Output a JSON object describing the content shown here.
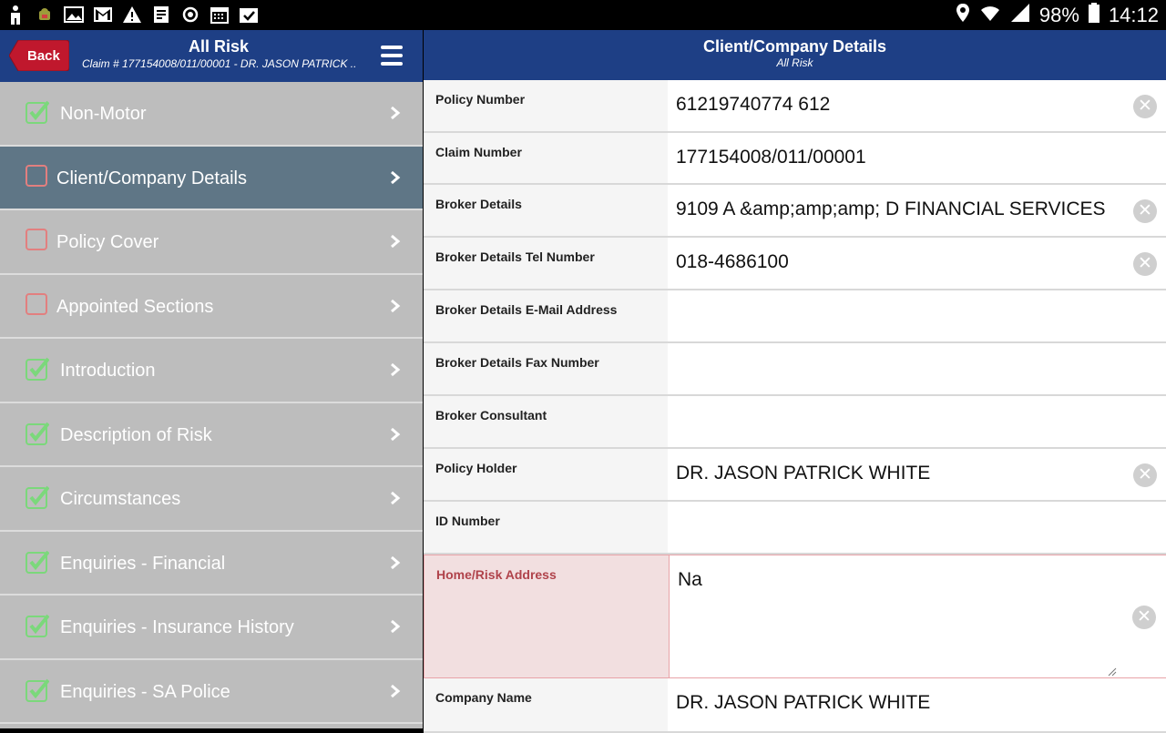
{
  "status_bar": {
    "battery": "98%",
    "time": "14:12",
    "icons": [
      "person-icon",
      "android-icon",
      "image-icon",
      "gmail-icon",
      "warning-icon",
      "document-icon",
      "sync-icon",
      "calendar-icon",
      "clipboard-check-icon",
      "location-icon",
      "wifi-icon",
      "signal-icon",
      "battery-icon"
    ]
  },
  "left_header": {
    "back_label": "Back",
    "title": "All Risk",
    "subtitle": "Claim # 177154008/011/00001 - DR. JASON PATRICK ..."
  },
  "nav": {
    "items": [
      {
        "label": "Non-Motor",
        "state": "checked"
      },
      {
        "label": "Client/Company Details",
        "state": "active"
      },
      {
        "label": "Policy Cover",
        "state": "unchecked"
      },
      {
        "label": "Appointed Sections",
        "state": "unchecked"
      },
      {
        "label": "Introduction",
        "state": "checked"
      },
      {
        "label": "Description of Risk",
        "state": "checked"
      },
      {
        "label": "Circumstances",
        "state": "checked"
      },
      {
        "label": "Enquiries - Financial",
        "state": "checked"
      },
      {
        "label": "Enquiries - Insurance History",
        "state": "checked"
      },
      {
        "label": "Enquiries - SA Police",
        "state": "checked"
      }
    ]
  },
  "right_header": {
    "title": "Client/Company Details",
    "subtitle": "All Risk"
  },
  "form": {
    "fields": [
      {
        "label": "Policy Number",
        "value": "61219740774 612",
        "clearable": true
      },
      {
        "label": "Claim Number",
        "value": "177154008/011/00001",
        "clearable": false
      },
      {
        "label": "Broker Details",
        "value": "9109 A &amp;amp;amp; D FINANCIAL SERVICES",
        "clearable": true
      },
      {
        "label": "Broker Details Tel Number",
        "value": "018-4686100",
        "clearable": true
      },
      {
        "label": "Broker Details E-Mail Address",
        "value": "",
        "clearable": false
      },
      {
        "label": "Broker Details Fax Number",
        "value": "",
        "clearable": false
      },
      {
        "label": "Broker Consultant",
        "value": "",
        "clearable": false
      },
      {
        "label": "Policy Holder",
        "value": "DR. JASON PATRICK WHITE",
        "clearable": true
      },
      {
        "label": "ID Number",
        "value": "",
        "clearable": false
      },
      {
        "label": "Home/Risk Address",
        "value": "Na",
        "clearable": true,
        "error": true
      },
      {
        "label": "Company Name",
        "value": "DR. JASON PATRICK WHITE",
        "clearable": false
      }
    ]
  },
  "colors": {
    "header_blue": "#1e3f85",
    "active_nav": "#5f7686",
    "check_green": "#7bd87b",
    "unchecked_red": "#e27f7f",
    "error_bg": "#f2dfe0",
    "error_text": "#b0434b"
  }
}
